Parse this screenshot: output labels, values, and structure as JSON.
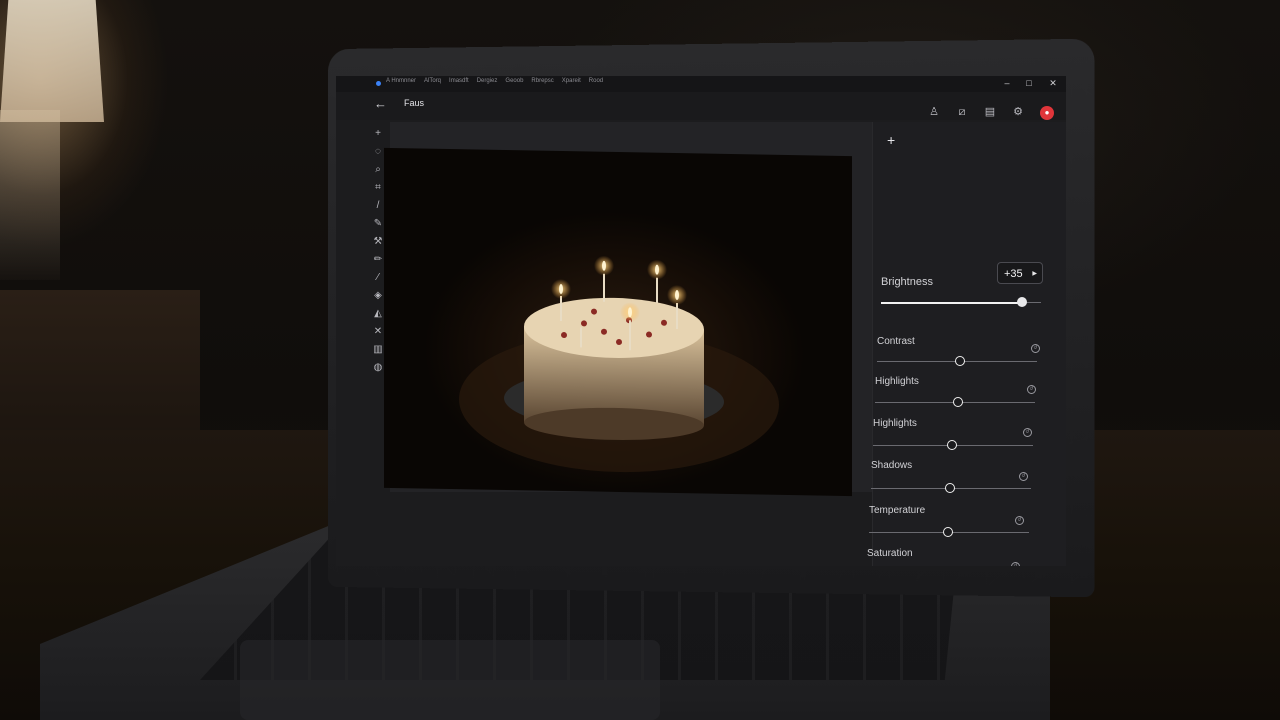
{
  "window": {
    "menu": [
      "A Hnmnner",
      "AlTorq",
      "Imasdft",
      "Dergiez",
      "Geoob",
      "Rbrepsc",
      "Xpareit",
      "Rood"
    ],
    "controls": {
      "minimize": "–",
      "maximize": "□",
      "close": "✕"
    }
  },
  "header": {
    "title": "Faus",
    "icons": [
      "person-adjust-icon",
      "crop-icon",
      "layers-icon",
      "settings-icon",
      "record-icon"
    ]
  },
  "toolbar": {
    "tools": [
      "add-icon",
      "lasso-icon",
      "zoom-icon",
      "crop-icon",
      "brush-icon",
      "pen-icon",
      "hammer-icon",
      "pencil-icon",
      "eyedropper-icon",
      "eraser-icon",
      "fill-icon",
      "transform-icon",
      "stamp-icon",
      "color-icon"
    ]
  },
  "panel": {
    "add_label": "+",
    "brightness": {
      "label": "Brightness",
      "value_text": "+35",
      "value": 35
    },
    "adjustments": [
      {
        "label": "Contrast"
      },
      {
        "label": "Highlights"
      },
      {
        "label": "Highlights"
      },
      {
        "label": "Shadows"
      },
      {
        "label": "Temperature"
      },
      {
        "label": "Saturation"
      }
    ]
  },
  "colors": {
    "accent": "#e0353a",
    "panel_bg": "#1e1e21"
  }
}
